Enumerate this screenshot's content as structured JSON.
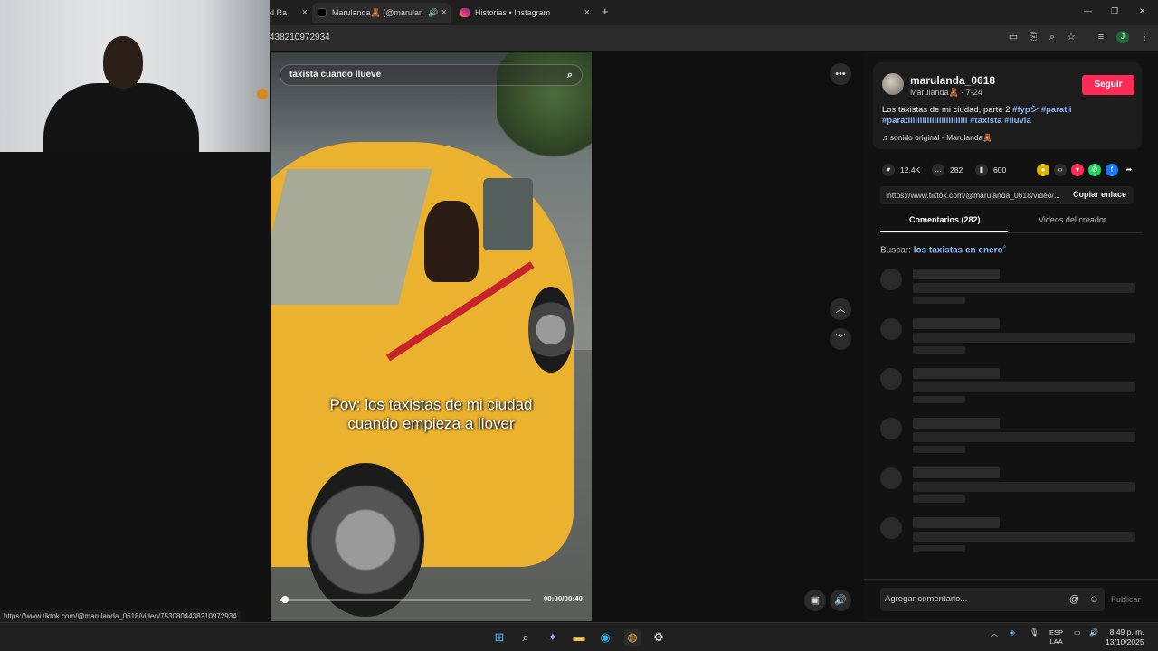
{
  "browser": {
    "tabs": [
      {
        "label": "d Ra",
        "close": "×"
      },
      {
        "label": "Marulanda🧸 (@marulanda",
        "close": "×"
      },
      {
        "label": "Historias • Instagram",
        "close": "×"
      }
    ],
    "new_tab": "+",
    "url": "438210972934",
    "window_controls": [
      "—",
      "❐",
      "✕"
    ]
  },
  "video": {
    "search_chip": "taxista cuando llueve",
    "caption": "Pov: los taxistas de mi ciudad\ncuando empieza a llover",
    "time": "00:00/00:40",
    "progress": 0.02
  },
  "panel": {
    "username": "marulanda_0618",
    "subline": "Marulanda🧸 · 7-24",
    "follow_label": "Seguir",
    "desc_text": "Los taxistas de mi ciudad, parte 2 ",
    "desc_tags": "#fypシ #paratii #paratiiiiiiiiiiiiiiiiiiiiiiiii #taxista #lluvia",
    "sound": "♫  sonido original - Marulanda🧸",
    "likes": "12.4K",
    "comments": "282",
    "saves": "600",
    "link": "https://www.tiktok.com/@marulanda_0618/video/...",
    "copy_link": "Copiar enlace",
    "tab_comments": "Comentarios (282)",
    "tab_videos": "Videos del creador",
    "search_prefix": "Buscar: ",
    "search_query": "los taxistas en enero",
    "comment_placeholder": "Agregar comentario...",
    "publish": "Publicar"
  },
  "status_url": "https://www.tiktok.com/@marulanda_0618/video/7530804438210972934",
  "taskbar": {
    "lang_top": "ESP",
    "lang_bottom": "LAA",
    "time": "8:49 p. m.",
    "date": "13/10/2025"
  },
  "colors": {
    "accent": "#fe2c55",
    "tag": "#8ab4f8"
  }
}
